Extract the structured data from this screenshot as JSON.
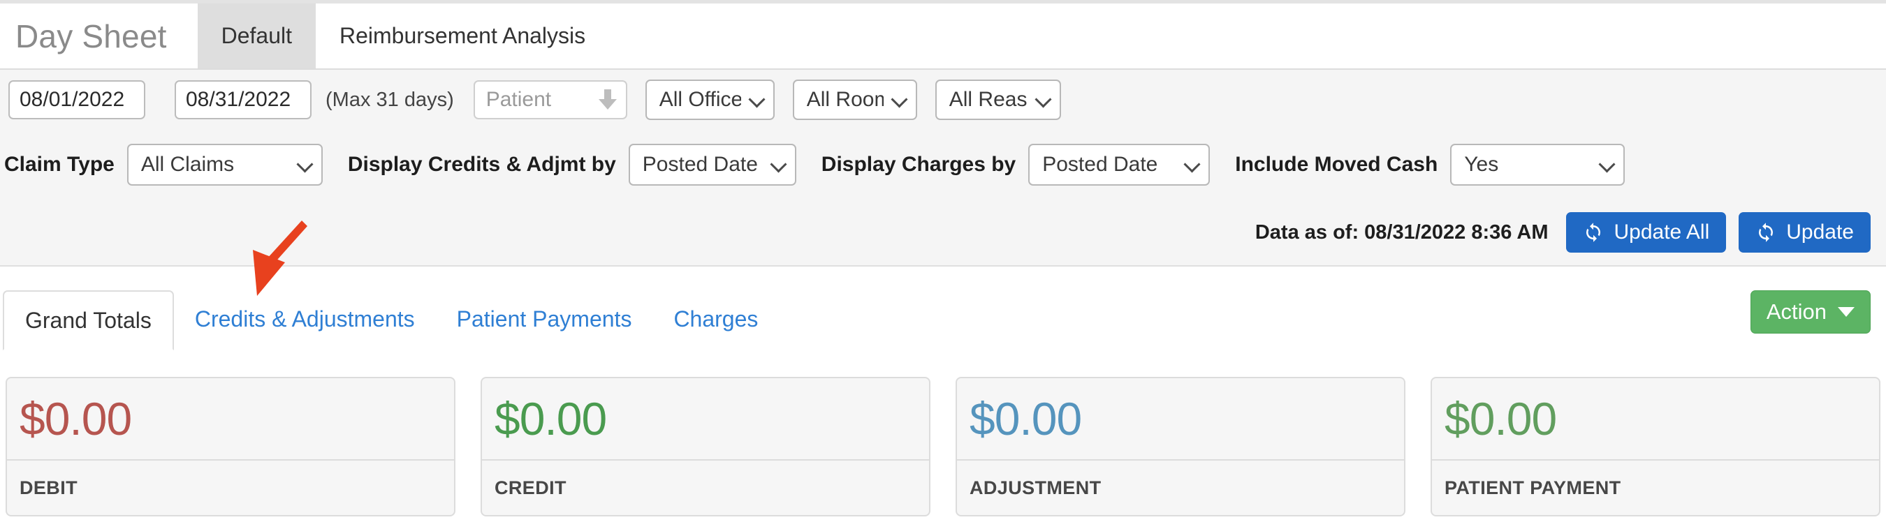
{
  "app": {
    "title": "Day Sheet"
  },
  "top_tabs": [
    {
      "label": "Default",
      "active": true
    },
    {
      "label": "Reimbursement Analysis",
      "active": false
    }
  ],
  "filters_row1": {
    "date_from": {
      "value": "08/01/2022",
      "name": "start-date-input"
    },
    "date_to": {
      "value": "08/31/2022",
      "name": "end-date-input"
    },
    "max_days_note": "(Max 31 days)",
    "patient": {
      "placeholder": "Patient",
      "value": ""
    },
    "office": {
      "value": "All Office"
    },
    "room": {
      "value": "All Room"
    },
    "reason": {
      "value": "All Reaso"
    }
  },
  "filters_row2": {
    "claim_type_label": "Claim Type",
    "claim_type_value": "All Claims",
    "credits_adjmt_label": "Display Credits & Adjmt by",
    "credits_adjmt_value": "Posted Date",
    "charges_label": "Display Charges by",
    "charges_value": "Posted Date",
    "moved_cash_label": "Include Moved Cash",
    "moved_cash_value": "Yes"
  },
  "status_row": {
    "data_as_of": "Data as of: 08/31/2022 8:36 AM",
    "update_all_label": "Update All",
    "update_label": "Update",
    "icon": "refresh-icon",
    "button_color": "#2069c4"
  },
  "tabs": [
    {
      "label": "Grand Totals",
      "active": true
    },
    {
      "label": "Credits & Adjustments",
      "active": false
    },
    {
      "label": "Patient Payments",
      "active": false
    },
    {
      "label": "Charges",
      "active": false
    }
  ],
  "action_button": {
    "label": "Action",
    "color": "#5cb464",
    "caret": "caret-down-icon"
  },
  "cards": [
    {
      "amount": "$0.00",
      "label": "DEBIT",
      "color": "#b6554f"
    },
    {
      "amount": "$0.00",
      "label": "CREDIT",
      "color": "#4a9b4f"
    },
    {
      "amount": "$0.00",
      "label": "ADJUSTMENT",
      "color": "#5594bd"
    },
    {
      "amount": "$0.00",
      "label": "PATIENT PAYMENT",
      "color": "#619e5e"
    }
  ],
  "annotation": {
    "type": "arrow",
    "color": "#e8411e",
    "points_to": "Credits & Adjustments"
  }
}
